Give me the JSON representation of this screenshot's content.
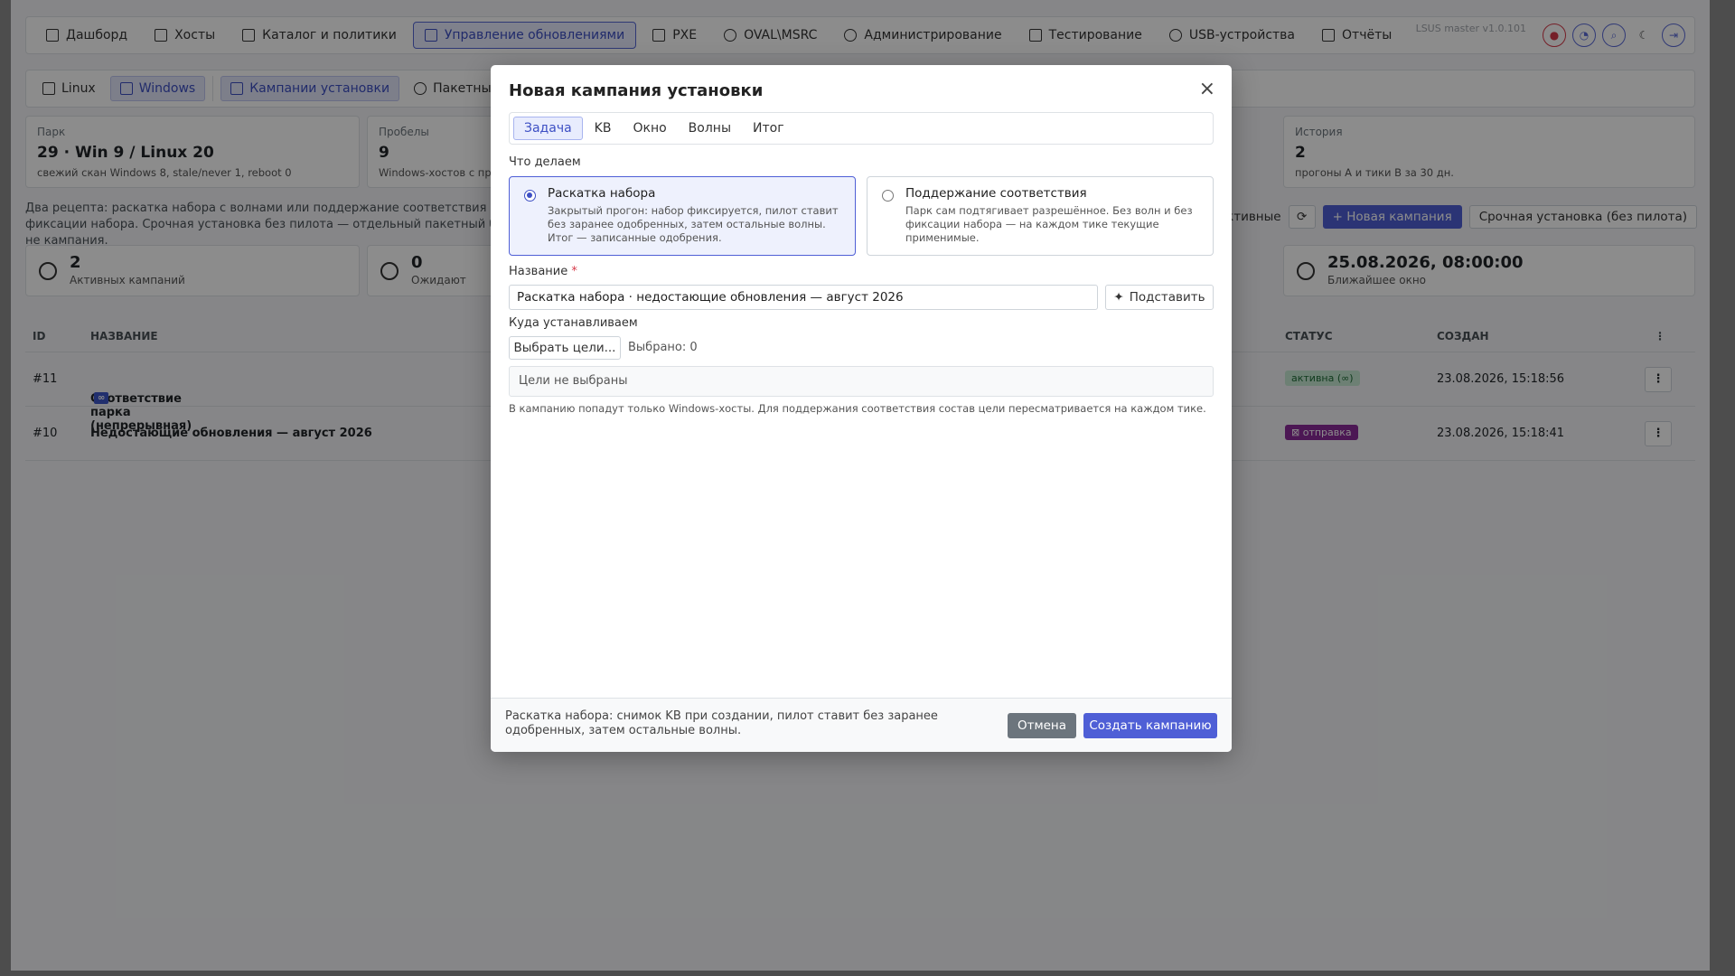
{
  "nav": {
    "items": [
      {
        "label": "Дашборд",
        "icon": "grid-icon"
      },
      {
        "label": "Хосты",
        "icon": "server-icon"
      },
      {
        "label": "Каталог и политики",
        "icon": "hierarchy-icon"
      },
      {
        "label": "Управление обновлениями",
        "icon": "file-update-icon",
        "active": true
      },
      {
        "label": "PXE",
        "icon": "box-icon"
      },
      {
        "label": "OVAL\\MSRC",
        "icon": "shield-icon"
      },
      {
        "label": "Администрирование",
        "icon": "gear-icon"
      },
      {
        "label": "Тестирование",
        "icon": "flask-icon"
      },
      {
        "label": "USB-устройства",
        "icon": "usb-icon"
      },
      {
        "label": "Отчёты",
        "icon": "report-icon"
      }
    ],
    "version": "LSUS master v1.0.101"
  },
  "subnav": {
    "items": [
      "Linux",
      "Windows",
      "Кампании установки",
      "Пакетные задания"
    ]
  },
  "stats": [
    {
      "label": "Парк",
      "big": "29 · Win 9 / Linux 20",
      "small": "свежий скан Windows 8, stale/never 1, reboot 0"
    },
    {
      "label": "Пробелы",
      "big": "9",
      "small": "Windows-хостов с пробелами"
    },
    {
      "label": "История",
      "big": "2",
      "small": "прогоны А и тики В за 30 дн."
    }
  ],
  "description": "Два рецепта: раскатка набора с волнами или поддержание соответствия без фиксации набора. Срочная установка без пилота — отдельный пакетный батч, не кампания.",
  "actions": {
    "only_active": "Только активные",
    "refresh_icon": "⟳",
    "new_campaign": "Новая кампания",
    "urgent": "Срочная установка (без пилота)"
  },
  "kpis": [
    {
      "big": "2",
      "small": "Активных кампаний"
    },
    {
      "big": "0",
      "small": "Ожидают"
    },
    {
      "big": "25.08.2026, 08:00:00",
      "small": "Ближайшее окно"
    }
  ],
  "table": {
    "headers": {
      "id": "ID",
      "name": "НАЗВАНИЕ",
      "status": "СТАТУС",
      "created": "СОЗДАН"
    },
    "rows": [
      {
        "id": "#11",
        "name": "Соответствие парка (непрерывная)",
        "badge": "∞",
        "status": "активна (∞)",
        "created": "23.08.2026, 15:18:56"
      },
      {
        "id": "#10",
        "name": "Недостающие обновления — август 2026",
        "status": "⊠ отправка",
        "created": "23.08.2026, 15:18:41"
      }
    ]
  },
  "modal": {
    "title": "Новая кампания установки",
    "close": "×",
    "tabs": [
      "Задача",
      "KB",
      "Окно",
      "Волны",
      "Итог"
    ],
    "what_label": "Что делаем",
    "options": [
      {
        "title": "Раскатка набора",
        "text": "Закрытый прогон: набор фиксируется, пилот ставит без заранее одобренных, затем остальные волны. Итог — записанные одобрения.",
        "selected": true
      },
      {
        "title": "Поддержание соответствия",
        "text": "Парк сам подтягивает разрешённое. Без волн и без фиксации набора — на каждом тике текущие применимые.",
        "selected": false
      }
    ],
    "name_label": "Название",
    "name_required": "*",
    "name_value": "Раскатка набора · недостающие обновления — август 2026",
    "suggest_label": "Подставить",
    "target_label": "Куда устанавливаем",
    "pick_label": "Выбрать цели...",
    "picked_label": "Выбрано: 0",
    "targets_empty": "Цели не выбраны",
    "hint": "В кампанию попадут только Windows-хосты. Для поддержания соответствия состав цели пересматривается на каждом тике.",
    "footer_text": "Раскатка набора: снимок KB при создании, пилот ставит без заранее одобренных, затем остальные волны.",
    "cancel": "Отмена",
    "create": "Создать кампанию"
  }
}
